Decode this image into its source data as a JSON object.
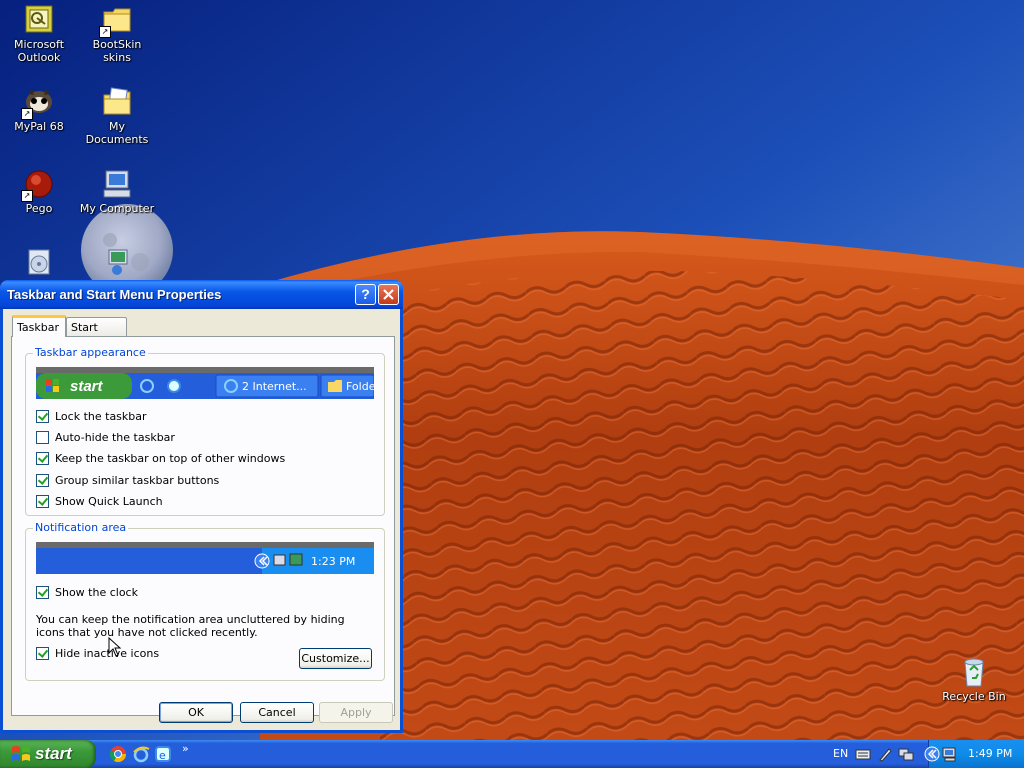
{
  "desktop": {
    "icons": [
      {
        "label_line1": "Microsoft",
        "label_line2": "Outlook",
        "icon": "outlook-icon"
      },
      {
        "label_line1": "BootSkin skins",
        "label_line2": "",
        "icon": "folder-icon"
      },
      {
        "label_line1": "MyPal 68",
        "label_line2": "",
        "icon": "mypal-browser-icon"
      },
      {
        "label_line1": "My Documents",
        "label_line2": "",
        "icon": "my-documents-icon"
      },
      {
        "label_line1": "Pego",
        "label_line2": "",
        "icon": "pego-icon"
      },
      {
        "label_line1": "My Computer",
        "label_line2": "",
        "icon": "my-computer-icon"
      },
      {
        "label_line1": "Recycle Bin",
        "label_line2": "",
        "icon": "recycle-bin-icon"
      }
    ]
  },
  "dialog": {
    "title": "Taskbar and Start Menu Properties",
    "help_label": "?",
    "close_label": "✕",
    "tabs": [
      {
        "label": "Taskbar",
        "active": true
      },
      {
        "label": "Start Menu",
        "active": false
      }
    ],
    "taskbar_group": {
      "title": "Taskbar appearance",
      "preview": {
        "start_label": "start",
        "button_label": "2 Internet...",
        "button2_label": "Folde"
      },
      "options": [
        {
          "label": "Lock the taskbar",
          "checked": true
        },
        {
          "label": "Auto-hide the taskbar",
          "checked": false
        },
        {
          "label": "Keep the taskbar on top of other windows",
          "checked": true
        },
        {
          "label": "Group similar taskbar buttons",
          "checked": true
        },
        {
          "label": "Show Quick Launch",
          "checked": true
        }
      ]
    },
    "notification_group": {
      "title": "Notification area",
      "preview_time": "1:23 PM",
      "show_clock": {
        "label": "Show the clock",
        "checked": true
      },
      "description": "You can keep the notification area uncluttered by hiding icons that you have not clicked recently.",
      "hide_inactive": {
        "label": "Hide inactive icons",
        "checked": true
      },
      "customize_label": "Customize..."
    },
    "buttons": {
      "ok": "OK",
      "cancel": "Cancel",
      "apply": "Apply"
    }
  },
  "taskbar": {
    "start_label": "start",
    "quick_launch": [
      "chrome-icon",
      "internet-explorer-icon",
      "ie-alt-icon"
    ],
    "overflow_label": "»",
    "language": "EN",
    "tray_icons": [
      "keyboard-icon",
      "pen-icon",
      "network-icon",
      "expand-tray-icon",
      "computer-tray-icon"
    ],
    "clock": "1:49 PM"
  },
  "colors": {
    "sky_top": "#0a2a8a",
    "sky_bottom": "#5a8ed8",
    "dune": "#c84a18",
    "xp_blue": "#245edb",
    "start_green": "#3c9a3a"
  }
}
